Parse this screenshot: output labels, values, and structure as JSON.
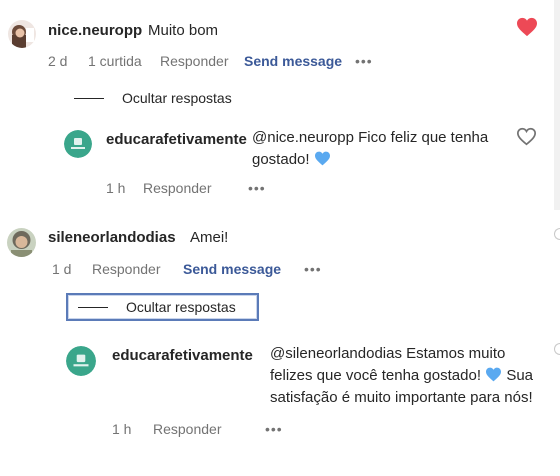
{
  "comments": [
    {
      "username": "nice.neuropp",
      "text": "Muito bom",
      "time": "2 d",
      "likes": "1 curtida",
      "reply_label": "Responder",
      "send_label": "Send message",
      "more": "•••",
      "heart_color": "#ed4956",
      "hide_replies": "Ocultar respostas",
      "reply": {
        "username": "educarafetivamente",
        "mention": "@nice.neuropp",
        "text": "Fico feliz que tenha gostado!",
        "emoji": "blue-heart",
        "time": "1 h",
        "reply_label": "Responder",
        "more": "•••"
      }
    },
    {
      "username": "sileneorlandodias",
      "text": "Amei!",
      "time": "1 d",
      "reply_label": "Responder",
      "send_label": "Send message",
      "more": "•••",
      "hide_replies": "Ocultar respostas",
      "reply": {
        "username": "educarafetivamente",
        "mention": "@sileneorlandodias",
        "line1": "Estamos muito",
        "line2": "felizes que você tenha gostado!",
        "line3": "Sua",
        "line4": "satisfação é muito importante para nós!",
        "emoji": "blue-heart",
        "time": "1 h",
        "reply_label": "Responder",
        "more": "•••"
      }
    }
  ],
  "colors": {
    "send_message": "#3b5998",
    "muted": "#737373",
    "brand_avatar": "#3aa68b",
    "emoji_blue": "#5aa9f0"
  }
}
